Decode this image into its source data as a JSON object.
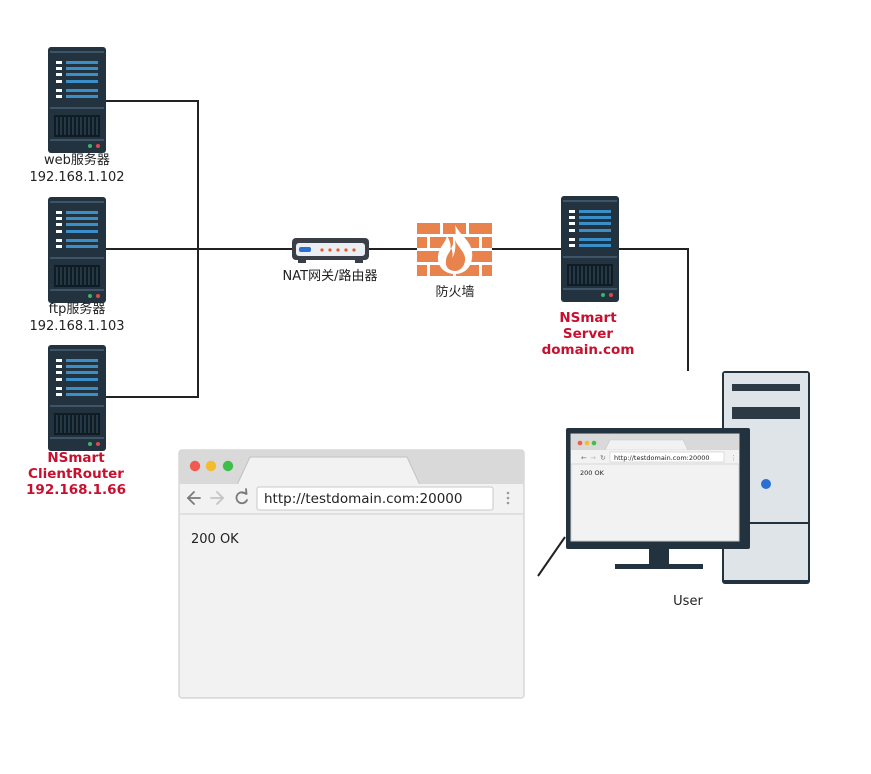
{
  "web_server": {
    "name": "web服务器",
    "ip": "192.168.1.102"
  },
  "ftp_server": {
    "name": "ftp服务器",
    "ip": "192.168.1.103"
  },
  "client_router": {
    "line1": "NSmart",
    "line2": "ClientRouter",
    "line3": "192.168.1.66"
  },
  "nat": {
    "label": "NAT网关/路由器"
  },
  "firewall": {
    "label": "防火墙"
  },
  "nsmart_server": {
    "line1": "NSmart",
    "line2": "Server",
    "line3": "domain.com"
  },
  "user": {
    "label": "User"
  },
  "browser_large": {
    "url": "http://testdomain.com:20000",
    "content": "200 OK"
  },
  "browser_small": {
    "url": "http://testdomain.com:20000",
    "content": "200 OK"
  },
  "colors": {
    "server_body": "#22333f",
    "server_bar": "#3b8fc9",
    "highlight": "#c8102e",
    "firewall": "#e8834e",
    "flame": "#ffffff",
    "browser_frame": "#d6d6d6",
    "link": "#222222"
  }
}
